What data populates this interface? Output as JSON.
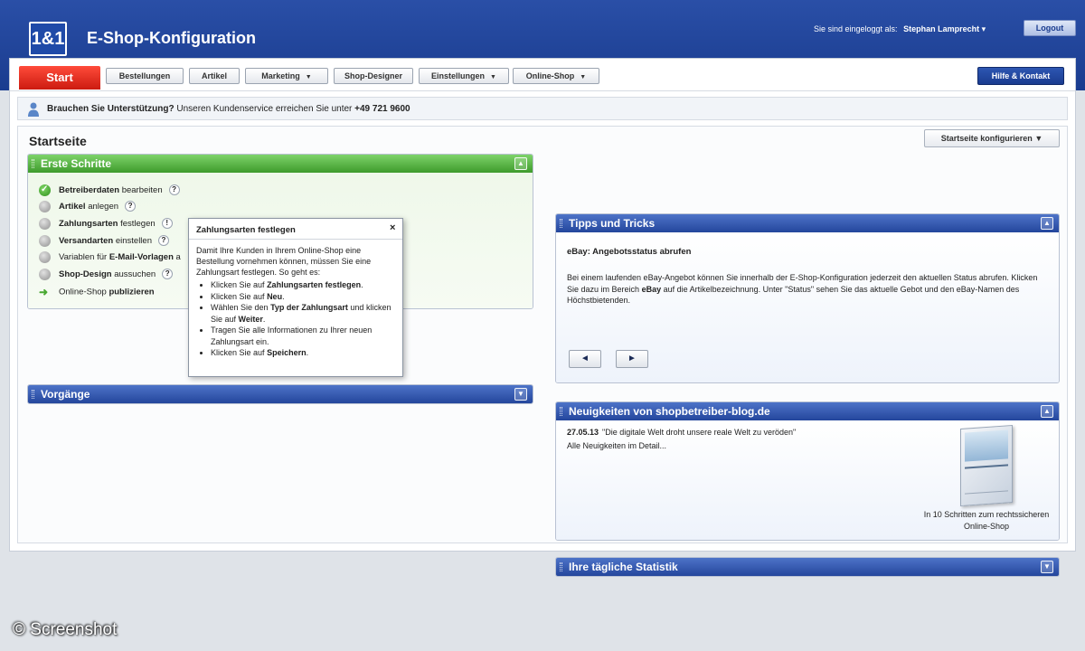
{
  "header": {
    "logo": "1&1",
    "title": "E-Shop-Konfiguration",
    "login_label": "Sie sind eingeloggt als:",
    "user_name": "Stephan Lamprecht",
    "logout": "Logout"
  },
  "nav": {
    "start": "Start",
    "items": [
      "Bestellungen",
      "Artikel",
      "Marketing",
      "Shop-Designer",
      "Einstellungen",
      "Online-Shop"
    ],
    "help": "Hilfe & Kontakt"
  },
  "support": {
    "question": "Brauchen Sie Unterstützung?",
    "text": "Unseren Kundenservice erreichen Sie unter",
    "phone": "+49 721 9600"
  },
  "page": {
    "title": "Startseite",
    "configure": "Startseite konfigurieren"
  },
  "erste_schritte": {
    "title": "Erste Schritte",
    "steps": [
      {
        "bold": "Betreiberdaten",
        "rest": "bearbeiten",
        "mark": "?"
      },
      {
        "bold": "Artikel",
        "rest": "anlegen",
        "mark": "?"
      },
      {
        "bold": "Zahlungsarten",
        "rest": "festlegen",
        "mark": "!"
      },
      {
        "bold": "Versandarten",
        "rest": "einstellen",
        "mark": "?"
      },
      {
        "pre": "Variablen für",
        "bold": "E-Mail-Vorlagen",
        "rest": "a"
      },
      {
        "bold": "Shop-Design",
        "rest": "aussuchen",
        "mark": "?"
      },
      {
        "pre": "Online-Shop",
        "bold": "publizieren"
      }
    ]
  },
  "vorgaenge": {
    "title": "Vorgänge"
  },
  "popup": {
    "title": "Zahlungsarten festlegen",
    "close": "×",
    "intro": "Damit Ihre Kunden in Ihrem Online-Shop eine Bestellung vornehmen können, müssen Sie eine Zahlungsart festlegen. So geht es:",
    "li1_pre": "Klicken Sie auf",
    "li1_bold": "Zahlungsarten festlegen",
    "li1_post": ".",
    "li2_pre": "Klicken Sie auf",
    "li2_bold": "Neu",
    "li2_post": ".",
    "li3_pre": "Wählen Sie den",
    "li3_bold": "Typ der Zahlungsart",
    "li3_mid": "und klicken Sie auf",
    "li3_bold2": "Weiter",
    "li3_post": ".",
    "li4": "Tragen Sie alle Informationen zu Ihrer neuen Zahlungsart ein.",
    "li5_pre": "Klicken Sie auf",
    "li5_bold": "Speichern",
    "li5_post": "."
  },
  "tipps": {
    "title": "Tipps und Tricks",
    "subtitle": "eBay: Angebotsstatus abrufen",
    "text1": "Bei einem laufenden eBay-Angebot können Sie innerhalb der E-Shop-Konfiguration jederzeit den aktuellen Status abrufen. Klicken Sie dazu im Bereich",
    "text_bold": "eBay",
    "text2": "auf die Artikelbezeichnung. Unter \"Status\" sehen Sie das aktuelle Gebot und den eBay-Namen des Höchstbietenden.",
    "prev": "◄",
    "next": "►"
  },
  "news": {
    "title": "Neuigkeiten von shopbetreiber-blog.de",
    "date": "27.05.13",
    "headline": "\"Die digitale Welt droht unsere reale Welt zu veröden\"",
    "all": "Alle Neuigkeiten im Detail...",
    "book_caption": "In 10 Schritten zum rechtssicheren Online-Shop"
  },
  "statistik": {
    "title": "Ihre tägliche Statistik"
  },
  "watermark": "© Screenshot"
}
